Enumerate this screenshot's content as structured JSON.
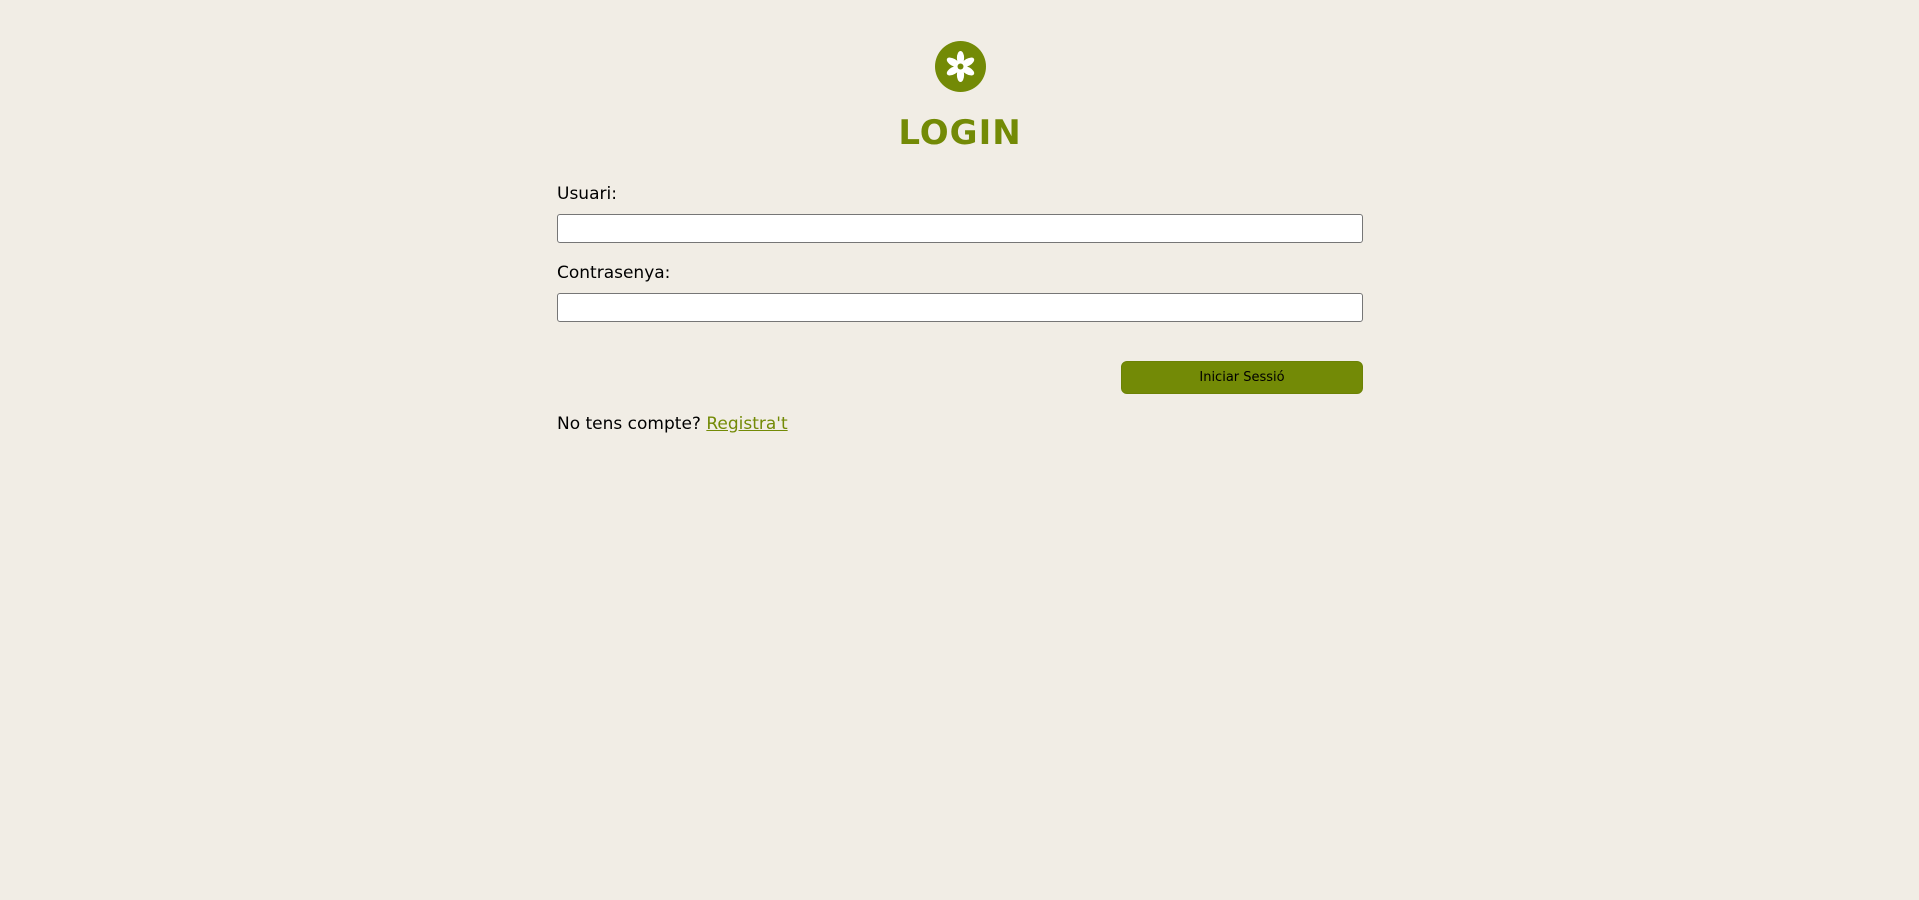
{
  "page": {
    "title": "LOGIN",
    "logo_icon": "flower-icon",
    "accent_color": "#738a06",
    "background_color": "#f1ede5"
  },
  "form": {
    "username_label": "Usuari:",
    "username_value": "",
    "password_label": "Contrasenya:",
    "password_value": "",
    "submit_label": "Iniciar Sessió"
  },
  "signup": {
    "prompt": "No tens compte?",
    "link_label": "Registra't"
  }
}
